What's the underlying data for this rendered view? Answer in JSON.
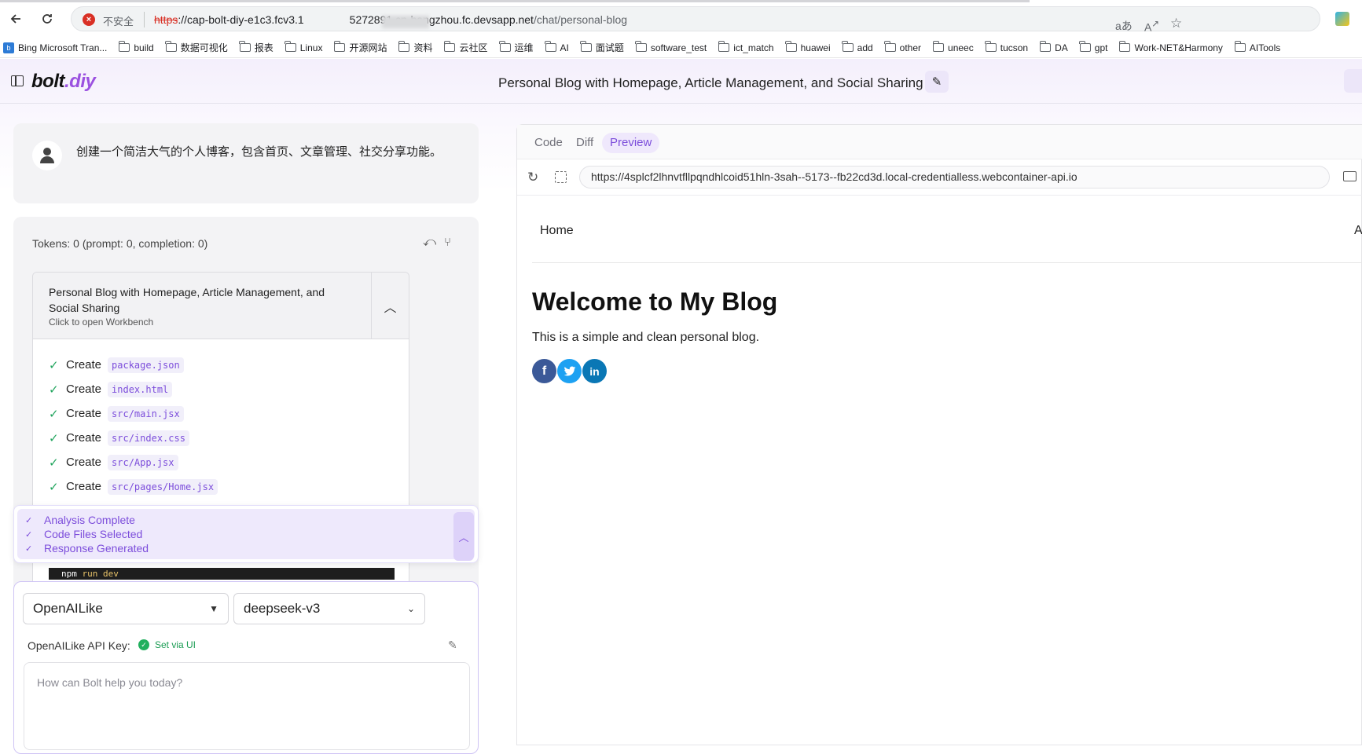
{
  "browser": {
    "insecure_label": "不安全",
    "url_scheme": "https",
    "url_host_prefix": "://cap-bolt-diy-e1c3.fcv3.1",
    "url_host_suffix": "5272891.cn-hangzhou.fc.devsapp.net",
    "url_path": "/chat/personal-blog",
    "bookmarks": [
      "Bing Microsoft Tran...",
      "build",
      "数据可视化",
      "报表",
      "Linux",
      "开源网站",
      "资料",
      "云社区",
      "运维",
      "AI",
      "面试题",
      "software_test",
      "ict_match",
      "huawei",
      "add",
      "other",
      "uneec",
      "tucson",
      "DA",
      "gpt",
      "Work-NET&Harmony",
      "AITools"
    ]
  },
  "app": {
    "logo_main": "bolt",
    "logo_suffix": ".diy",
    "chat_title": "Personal Blog with Homepage, Article Management, and Social Sharing"
  },
  "chat": {
    "user_message": "创建一个简洁大气的个人博客，包含首页、文章管理、社交分享功能。",
    "tokens": "Tokens: 0 (prompt: 0, completion: 0)",
    "artifact_title": "Personal Blog with Homepage, Article Management, and Social Sharing",
    "artifact_subtitle": "Click to open Workbench",
    "file_verb": "Create",
    "files": [
      "package.json",
      "index.html",
      "src/main.jsx",
      "src/index.css",
      "src/App.jsx",
      "src/pages/Home.jsx"
    ],
    "progress": [
      "Analysis Complete",
      "Code Files Selected",
      "Response Generated"
    ],
    "terminal_cmd": "npm",
    "terminal_args": " run dev"
  },
  "input": {
    "provider": "OpenAILike",
    "model": "deepseek-v3",
    "api_key_label": "OpenAILike API Key:",
    "api_key_status": "Set via UI",
    "placeholder": "How can Bolt help you today?"
  },
  "workbench": {
    "tabs": [
      "Code",
      "Diff",
      "Preview"
    ],
    "active_tab": "Preview",
    "preview_url": "https://4splcf2lhnvtfllpqndhlcoid51hln-3sah--5173--fb22cd3d.local-credentialless.webcontainer-api.io"
  },
  "preview": {
    "nav_home": "Home",
    "nav_articles": "Arti",
    "heading": "Welcome to My Blog",
    "paragraph": "This is a simple and clean personal blog.",
    "social": [
      "f",
      "t",
      "in"
    ]
  }
}
